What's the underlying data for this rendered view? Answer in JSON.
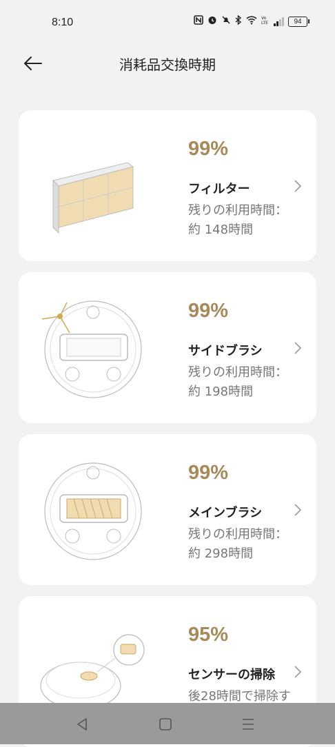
{
  "status": {
    "time": "8:10",
    "battery": "94"
  },
  "header": {
    "title": "消耗品交換時期"
  },
  "items": [
    {
      "percent": "99%",
      "name": "フィルター",
      "remain_line1": "残りの利用時間：",
      "remain_line2": "約 148時間"
    },
    {
      "percent": "99%",
      "name": "サイドブラシ",
      "remain_line1": "残りの利用時間：",
      "remain_line2": "約 198時間"
    },
    {
      "percent": "99%",
      "name": "メインブラシ",
      "remain_line1": "残りの利用時間：",
      "remain_line2": "約 298時間"
    },
    {
      "percent": "95%",
      "name": "センサーの掃除",
      "remain_line1": "後28時間で掃除す",
      "remain_line2": ""
    }
  ],
  "colors": {
    "accent": "#a88a5a",
    "background": "#f2f2f2",
    "card": "#ffffff",
    "nav_bar": "#9a9a9a"
  },
  "icons": [
    "back-arrow-icon",
    "chevron-right-icon",
    "nav-back-icon",
    "nav-home-icon",
    "nav-menu-icon"
  ]
}
